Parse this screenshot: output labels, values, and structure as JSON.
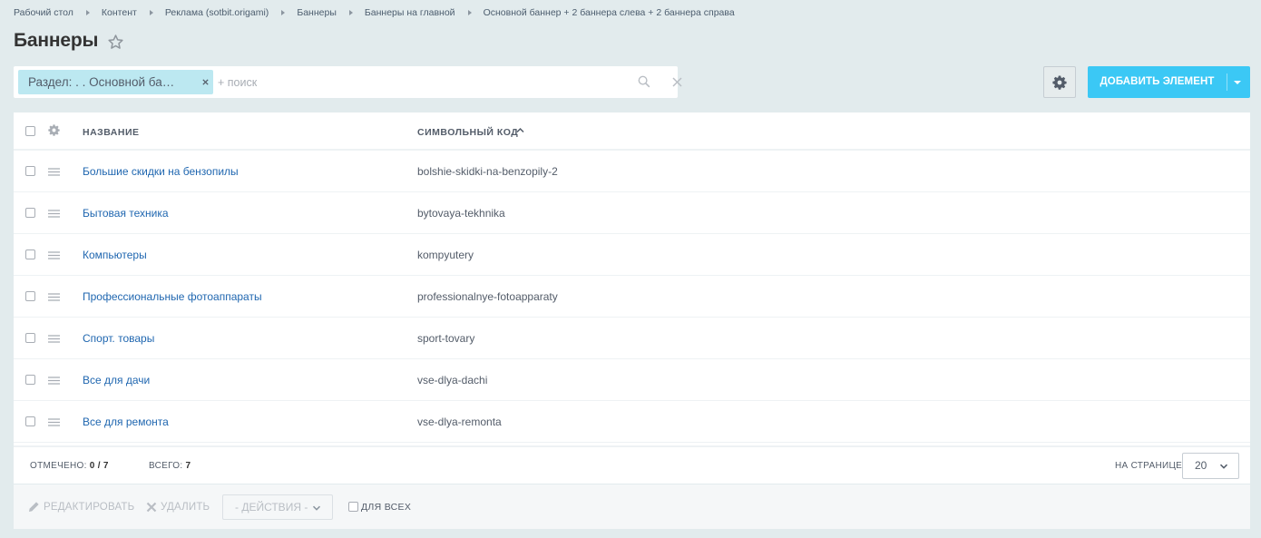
{
  "breadcrumb": [
    "Рабочий стол",
    "Контент",
    "Реклама (sotbit.origami)",
    "Баннеры",
    "Баннеры на главной",
    "Основной баннер + 2 баннера слева + 2 баннера справа"
  ],
  "page": {
    "title": "Баннеры",
    "star_icon": "star-icon"
  },
  "filter": {
    "chip_label": "Раздел: . . Основной ба…",
    "placeholder": "+ поиск",
    "search_icon": "search-icon",
    "clear_icon": "close-icon"
  },
  "toolbar": {
    "settings_icon": "gear-icon",
    "add_label": "ДОБАВИТЬ ЭЛЕМЕНТ",
    "accent_color": "#3bc8f5"
  },
  "grid": {
    "columns": {
      "name": "НАЗВАНИЕ",
      "code": "СИМВОЛЬНЫЙ КОД"
    },
    "sort": "ascending",
    "rows": [
      {
        "name": "Большие скидки на бензопилы",
        "code": "bolshie-skidki-na-benzopily-2"
      },
      {
        "name": "Бытовая техника",
        "code": "bytovaya-tekhnika"
      },
      {
        "name": "Компьютеры",
        "code": "kompyutery"
      },
      {
        "name": "Профессиональные фотоаппараты",
        "code": "professionalnye-fotoapparaty"
      },
      {
        "name": "Спорт. товары",
        "code": "sport-tovary"
      },
      {
        "name": "Все для дачи",
        "code": "vse-dlya-dachi"
      },
      {
        "name": "Все для ремонта",
        "code": "vse-dlya-remonta"
      }
    ]
  },
  "footer": {
    "selected_label": "ОТМЕЧЕНО:",
    "selected_value": "0 / 7",
    "total_label": "ВСЕГО:",
    "total_value": "7",
    "per_page_label": "НА СТРАНИЦЕ:",
    "per_page_value": "20"
  },
  "actions": {
    "edit_label": "РЕДАКТИРОВАТЬ",
    "delete_label": "УДАЛИТЬ",
    "select_label": "- ДЕЙСТВИЯ -",
    "for_all_label": "ДЛЯ ВСЕХ"
  }
}
